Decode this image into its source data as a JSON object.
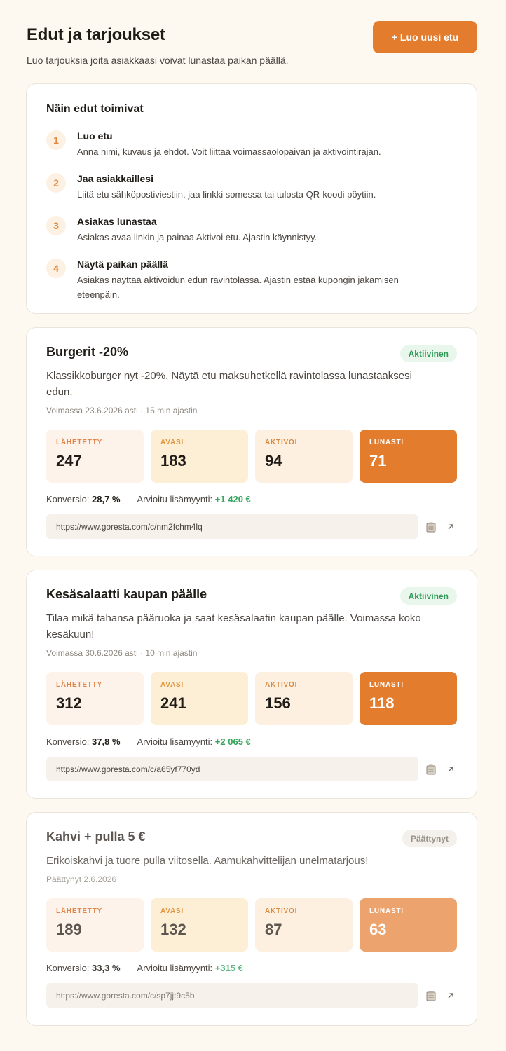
{
  "header": {
    "title": "Edut ja tarjoukset",
    "subtitle": "Luo tarjouksia joita asiakkaasi voivat lunastaa paikan päällä.",
    "new_button": "+ Luo uusi etu"
  },
  "how_it_works": {
    "title": "Näin edut toimivat",
    "steps": [
      {
        "num": "1",
        "title": "Luo etu",
        "desc": "Anna nimi, kuvaus ja ehdot. Voit liittää voimassaolopäivän ja aktivointirajan."
      },
      {
        "num": "2",
        "title": "Jaa asiakkaillesi",
        "desc": "Liitä etu sähköpostiviestiin, jaa linkki somessa tai tulosta QR-koodi pöytiin."
      },
      {
        "num": "3",
        "title": "Asiakas lunastaa",
        "desc": "Asiakas avaa linkin ja painaa Aktivoi etu. Ajastin käynnistyy."
      },
      {
        "num": "4",
        "title": "Näytä paikan päällä",
        "desc": "Asiakas näyttää aktivoidun edun ravintolassa. Ajastin estää kupongin jakamisen eteenpäin."
      }
    ]
  },
  "stat_labels": {
    "sent": "LÄHETETTY",
    "opened": "AVASI",
    "activated": "AKTIVOI",
    "redeemed": "LUNASTI"
  },
  "metric_labels": {
    "conversion": "Konversio:",
    "uplift": "Arvioitu lisämyynti:"
  },
  "offers": [
    {
      "title": "Burgerit -20%",
      "status": "Aktiivinen",
      "desc": "Klassikkoburger nyt -20%. Näytä etu maksuhetkellä ravintolassa lunastaaksesi edun.",
      "meta": "Voimassa 23.6.2026 asti · 15 min ajastin",
      "sent": "247",
      "opened": "183",
      "activated": "94",
      "redeemed": "71",
      "conversion": "28,7 %",
      "uplift": "+1 420 €",
      "link": "https://www.goresta.com/c/nm2fchm4lq"
    },
    {
      "title": "Kesäsalaatti kaupan päälle",
      "status": "Aktiivinen",
      "desc": "Tilaa mikä tahansa pääruoka ja saat kesäsalaatin kaupan päälle. Voimassa koko kesäkuun!",
      "meta": "Voimassa 30.6.2026 asti · 10 min ajastin",
      "sent": "312",
      "opened": "241",
      "activated": "156",
      "redeemed": "118",
      "conversion": "37,8 %",
      "uplift": "+2 065 €",
      "link": "https://www.goresta.com/c/a65yf770yd"
    },
    {
      "title": "Kahvi + pulla 5 €",
      "status": "Päättynyt",
      "desc": "Erikoiskahvi ja tuore pulla viitosella. Aamukahvittelijan unelmatarjous!",
      "meta": "Päättynyt 2.6.2026",
      "sent": "189",
      "opened": "132",
      "activated": "87",
      "redeemed": "63",
      "conversion": "33,3 %",
      "uplift": "+315 €",
      "link": "https://www.goresta.com/c/sp7jjt9c5b"
    }
  ],
  "icons": {
    "copy": "clipboard-icon",
    "open": "external-link-icon"
  },
  "colors": {
    "accent": "#e47c2e",
    "active_badge": "#2f9a57",
    "uplift": "#35a55d"
  }
}
